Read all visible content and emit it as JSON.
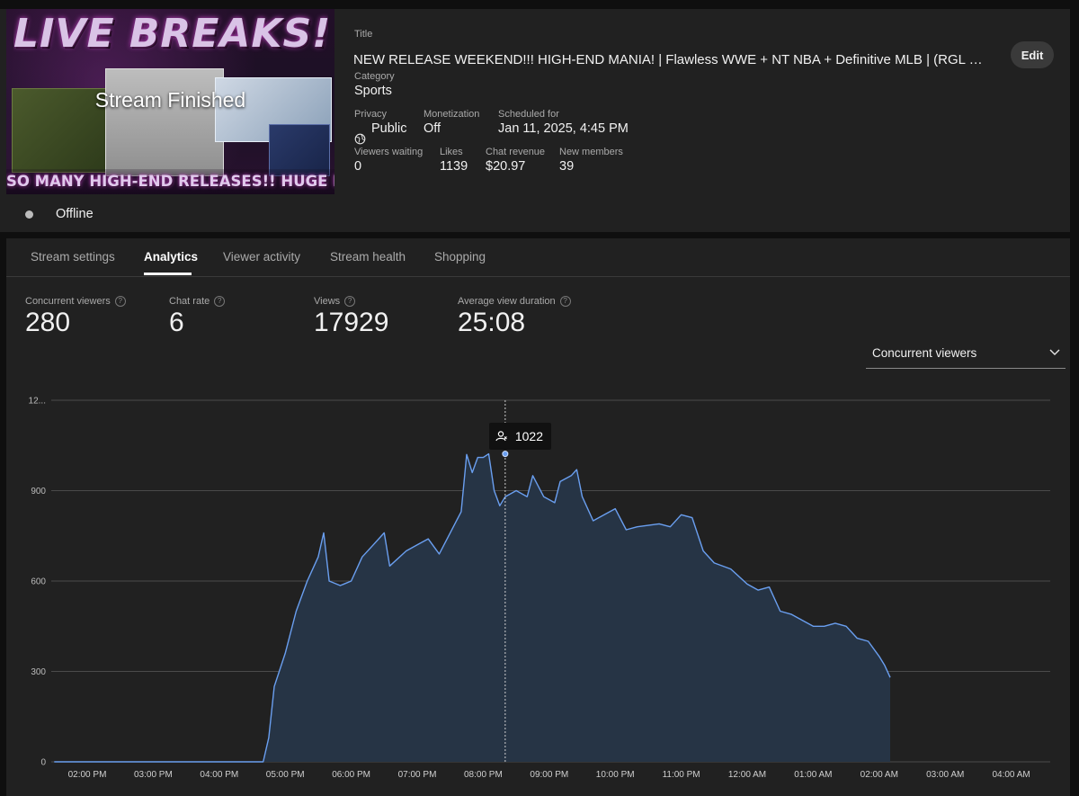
{
  "thumbnail": {
    "title_art": "LIVE BREAKS!",
    "overlay_text": "Stream Finished",
    "banner_art": "SO MANY HIGH-END RELEASES!! HUGE BREAKS!"
  },
  "details": {
    "title_label": "Title",
    "title_value": "NEW RELEASE WEEKEND!!! HIGH-END MANIA! | Flawless WWE + NT NBA + Definitive MLB | (RGL #...",
    "edit_label": "Edit",
    "category_label": "Category",
    "category_value": "Sports",
    "privacy_label": "Privacy",
    "privacy_value": "Public",
    "privacy_icon": "globe-icon",
    "monetization_label": "Monetization",
    "monetization_value": "Off",
    "scheduled_label": "Scheduled for",
    "scheduled_value": "Jan 11, 2025, 4:45 PM",
    "viewers_waiting_label": "Viewers waiting",
    "viewers_waiting_value": "0",
    "likes_label": "Likes",
    "likes_value": "1139",
    "chat_revenue_label": "Chat revenue",
    "chat_revenue_value": "$20.97",
    "new_members_label": "New members",
    "new_members_value": "39"
  },
  "status": {
    "text": "Offline",
    "dot_color": "#bcbcbc"
  },
  "tabs": [
    {
      "label": "Stream settings",
      "active": false
    },
    {
      "label": "Analytics",
      "active": true
    },
    {
      "label": "Viewer activity",
      "active": false
    },
    {
      "label": "Stream health",
      "active": false
    },
    {
      "label": "Shopping",
      "active": false
    }
  ],
  "stats": {
    "concurrent_label": "Concurrent viewers",
    "concurrent_value": "280",
    "chat_rate_label": "Chat rate",
    "chat_rate_value": "6",
    "views_label": "Views",
    "views_value": "17929",
    "avg_duration_label": "Average view duration",
    "avg_duration_value": "25:08"
  },
  "metric_select": {
    "value": "Concurrent viewers"
  },
  "tooltip": {
    "value": "1022",
    "icon": "viewers-icon",
    "time": "08:20 PM"
  },
  "colors": {
    "accent_line": "#6a9ff0",
    "area_fill": "#263445",
    "panel_bg": "#212121"
  },
  "chart_data": {
    "type": "area",
    "y_tick_labels": [
      "0",
      "300",
      "600",
      "900",
      "12..."
    ],
    "ylim": [
      0,
      1200
    ],
    "x_tick_labels": [
      "02:00 PM",
      "03:00 PM",
      "04:00 PM",
      "05:00 PM",
      "06:00 PM",
      "07:00 PM",
      "08:00 PM",
      "09:00 PM",
      "10:00 PM",
      "11:00 PM",
      "12:00 AM",
      "01:00 AM",
      "02:00 AM",
      "03:00 AM",
      "04:00 AM"
    ],
    "grid": true,
    "series": [
      {
        "points": [
          [
            "01:30 PM",
            0
          ],
          [
            "04:00 PM",
            0
          ],
          [
            "04:40 PM",
            0
          ],
          [
            "04:45 PM",
            80
          ],
          [
            "04:50 PM",
            250
          ],
          [
            "05:00 PM",
            360
          ],
          [
            "05:10 PM",
            500
          ],
          [
            "05:20 PM",
            600
          ],
          [
            "05:30 PM",
            680
          ],
          [
            "05:35 PM",
            760
          ],
          [
            "05:40 PM",
            600
          ],
          [
            "05:50 PM",
            585
          ],
          [
            "06:00 PM",
            600
          ],
          [
            "06:10 PM",
            680
          ],
          [
            "06:20 PM",
            720
          ],
          [
            "06:30 PM",
            760
          ],
          [
            "06:35 PM",
            650
          ],
          [
            "06:50 PM",
            700
          ],
          [
            "07:00 PM",
            720
          ],
          [
            "07:10 PM",
            740
          ],
          [
            "07:20 PM",
            690
          ],
          [
            "07:30 PM",
            760
          ],
          [
            "07:40 PM",
            830
          ],
          [
            "07:45 PM",
            1020
          ],
          [
            "07:50 PM",
            960
          ],
          [
            "07:55 PM",
            1010
          ],
          [
            "08:00 PM",
            1010
          ],
          [
            "08:05 PM",
            1022
          ],
          [
            "08:10 PM",
            900
          ],
          [
            "08:15 PM",
            850
          ],
          [
            "08:20 PM",
            880
          ],
          [
            "08:30 PM",
            900
          ],
          [
            "08:40 PM",
            880
          ],
          [
            "08:45 PM",
            950
          ],
          [
            "08:55 PM",
            880
          ],
          [
            "09:05 PM",
            860
          ],
          [
            "09:10 PM",
            930
          ],
          [
            "09:20 PM",
            950
          ],
          [
            "09:25 PM",
            970
          ],
          [
            "09:30 PM",
            880
          ],
          [
            "09:40 PM",
            800
          ],
          [
            "09:50 PM",
            820
          ],
          [
            "10:00 PM",
            840
          ],
          [
            "10:10 PM",
            770
          ],
          [
            "10:20 PM",
            780
          ],
          [
            "10:40 PM",
            790
          ],
          [
            "10:50 PM",
            780
          ],
          [
            "11:00 PM",
            820
          ],
          [
            "11:10 PM",
            810
          ],
          [
            "11:20 PM",
            700
          ],
          [
            "11:30 PM",
            660
          ],
          [
            "11:45 PM",
            640
          ],
          [
            "12:00 AM",
            590
          ],
          [
            "12:10 AM",
            570
          ],
          [
            "12:20 AM",
            580
          ],
          [
            "12:30 AM",
            500
          ],
          [
            "12:40 AM",
            490
          ],
          [
            "12:50 AM",
            470
          ],
          [
            "01:00 AM",
            450
          ],
          [
            "01:10 AM",
            450
          ],
          [
            "01:20 AM",
            460
          ],
          [
            "01:30 AM",
            450
          ],
          [
            "01:40 AM",
            410
          ],
          [
            "01:50 AM",
            400
          ],
          [
            "02:00 AM",
            350
          ],
          [
            "02:05 AM",
            320
          ],
          [
            "02:10 AM",
            280
          ]
        ]
      }
    ]
  }
}
